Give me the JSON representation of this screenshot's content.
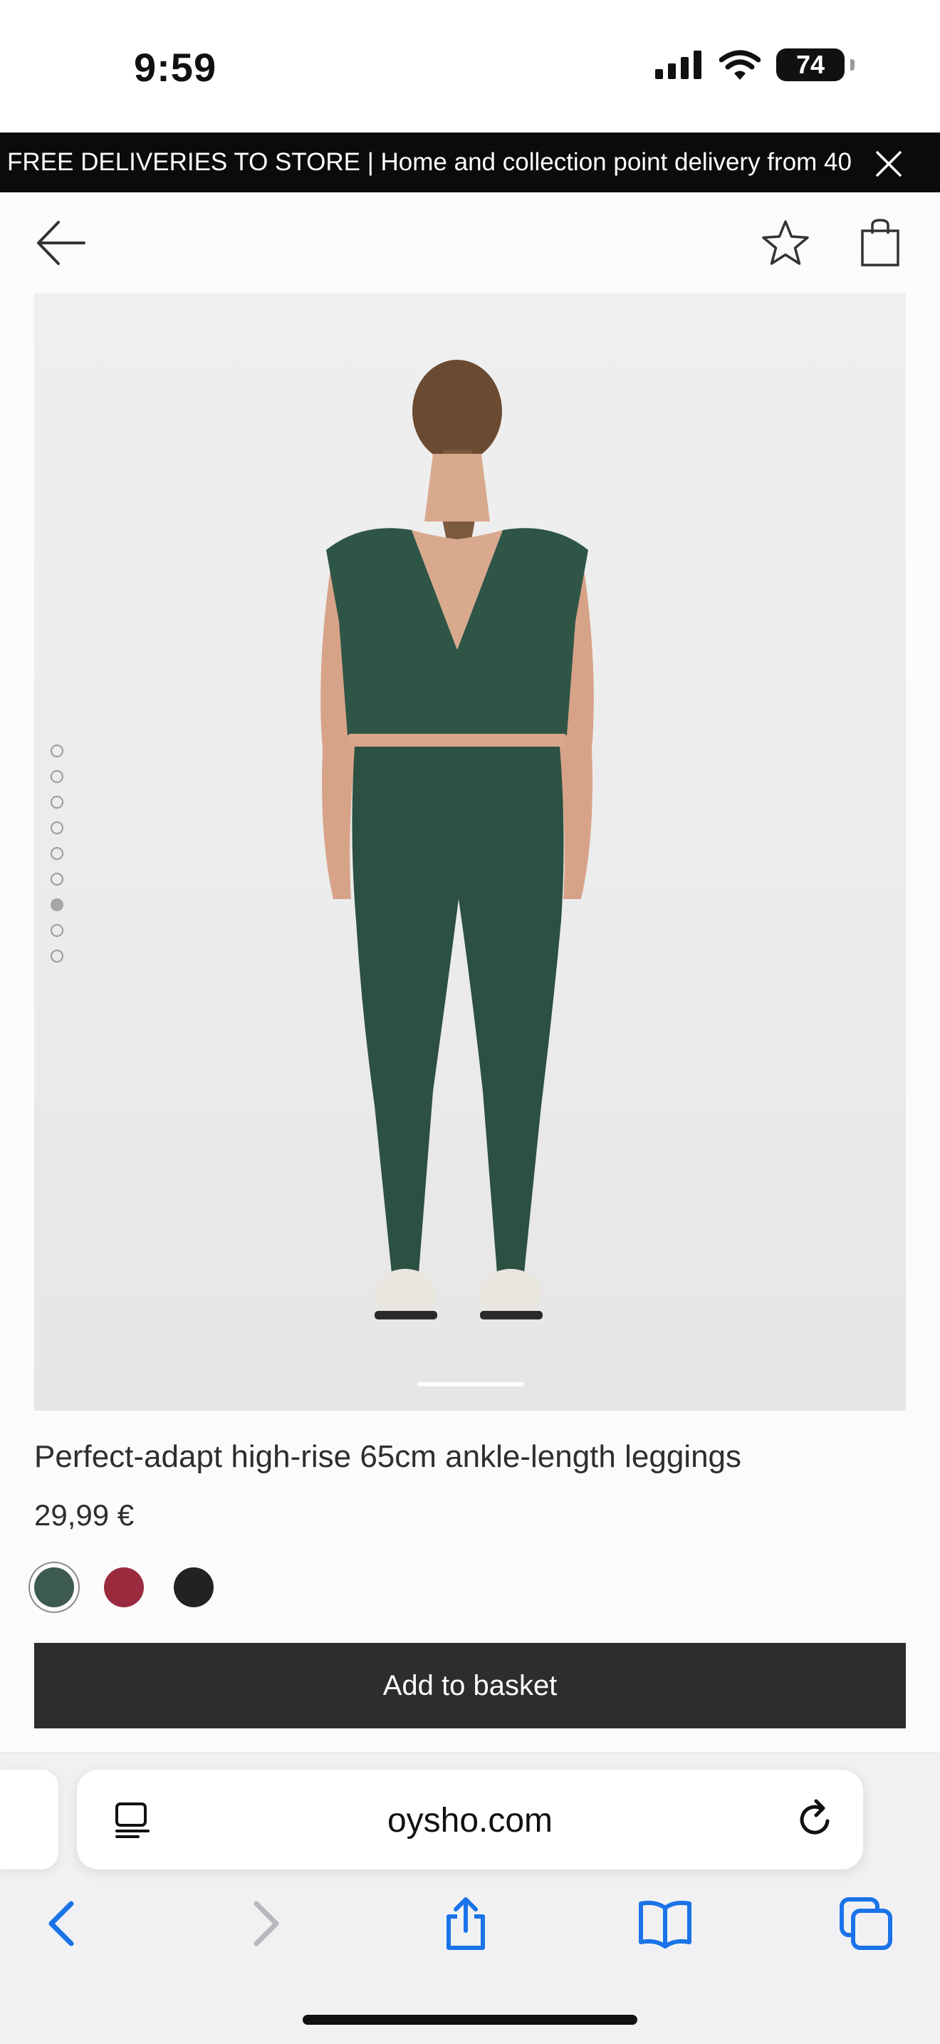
{
  "status_bar": {
    "time": "9:59",
    "battery": "74"
  },
  "promo": {
    "text": "FREE DELIVERIES TO STORE | Home and collection point delivery from 40"
  },
  "header": {
    "back_icon": "arrow-left-icon",
    "favorite_icon": "star-icon",
    "bag_icon": "shopping-bag-icon"
  },
  "gallery": {
    "image_count": 9,
    "active_index": 6
  },
  "product": {
    "title": "Perfect-adapt high-rise 65cm ankle-length leggings",
    "price": "29,99 €",
    "colors": [
      {
        "name": "green",
        "hex": "#3c5a4d",
        "selected": true
      },
      {
        "name": "red",
        "hex": "#9a2a3d",
        "selected": false
      },
      {
        "name": "black",
        "hex": "#222222",
        "selected": false
      }
    ],
    "add_to_basket": "Add to basket"
  },
  "browser": {
    "url": "oysho.com",
    "icons": [
      "reader-icon",
      "reload-icon",
      "back-icon",
      "forward-icon",
      "share-icon",
      "bookmarks-icon",
      "tabs-icon"
    ]
  }
}
